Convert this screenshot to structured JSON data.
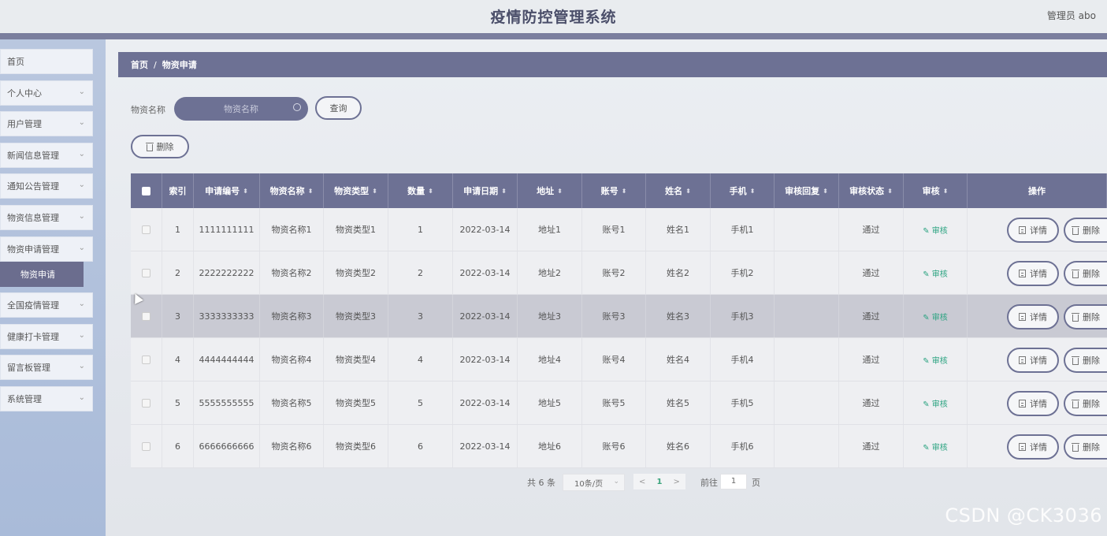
{
  "header": {
    "title": "疫情防控管理系统",
    "user": "管理员 abo"
  },
  "sidebar": {
    "items": [
      {
        "label": "首页",
        "has_chevron": false
      },
      {
        "label": "个人中心",
        "has_chevron": true
      },
      {
        "label": "用户管理",
        "has_chevron": true
      },
      {
        "label": "新闻信息管理",
        "has_chevron": true
      },
      {
        "label": "通知公告管理",
        "has_chevron": true
      },
      {
        "label": "物资信息管理",
        "has_chevron": true
      },
      {
        "label": "物资申请管理",
        "has_chevron": true
      },
      {
        "label": "全国疫情管理",
        "has_chevron": true
      },
      {
        "label": "健康打卡管理",
        "has_chevron": true
      },
      {
        "label": "留言板管理",
        "has_chevron": true
      },
      {
        "label": "系统管理",
        "has_chevron": true
      }
    ],
    "active_sub": "物资申请"
  },
  "breadcrumb": {
    "home": "首页",
    "sep": "/",
    "current": "物资申请"
  },
  "search": {
    "label": "物资名称",
    "placeholder": "物资名称",
    "button": "查询"
  },
  "toolbar": {
    "delete": "删除"
  },
  "table": {
    "headers": [
      "索引",
      "申请编号",
      "物资名称",
      "物资类型",
      "数量",
      "申请日期",
      "地址",
      "账号",
      "姓名",
      "手机",
      "审核回复",
      "审核状态",
      "审核",
      "操作"
    ],
    "rows": [
      {
        "index": "1",
        "no": "1111111111",
        "name": "物资名称1",
        "type": "物资类型1",
        "qty": "1",
        "date": "2022-03-14",
        "addr": "地址1",
        "account": "账号1",
        "person": "姓名1",
        "phone": "手机1",
        "reply": "",
        "status": "通过",
        "audit": "审核"
      },
      {
        "index": "2",
        "no": "2222222222",
        "name": "物资名称2",
        "type": "物资类型2",
        "qty": "2",
        "date": "2022-03-14",
        "addr": "地址2",
        "account": "账号2",
        "person": "姓名2",
        "phone": "手机2",
        "reply": "",
        "status": "通过",
        "audit": "审核"
      },
      {
        "index": "3",
        "no": "3333333333",
        "name": "物资名称3",
        "type": "物资类型3",
        "qty": "3",
        "date": "2022-03-14",
        "addr": "地址3",
        "account": "账号3",
        "person": "姓名3",
        "phone": "手机3",
        "reply": "",
        "status": "通过",
        "audit": "审核"
      },
      {
        "index": "4",
        "no": "4444444444",
        "name": "物资名称4",
        "type": "物资类型4",
        "qty": "4",
        "date": "2022-03-14",
        "addr": "地址4",
        "account": "账号4",
        "person": "姓名4",
        "phone": "手机4",
        "reply": "",
        "status": "通过",
        "audit": "审核"
      },
      {
        "index": "5",
        "no": "5555555555",
        "name": "物资名称5",
        "type": "物资类型5",
        "qty": "5",
        "date": "2022-03-14",
        "addr": "地址5",
        "account": "账号5",
        "person": "姓名5",
        "phone": "手机5",
        "reply": "",
        "status": "通过",
        "audit": "审核"
      },
      {
        "index": "6",
        "no": "6666666666",
        "name": "物资名称6",
        "type": "物资类型6",
        "qty": "6",
        "date": "2022-03-14",
        "addr": "地址6",
        "account": "账号6",
        "person": "姓名6",
        "phone": "手机6",
        "reply": "",
        "status": "通过",
        "audit": "审核"
      }
    ],
    "actions": {
      "detail": "详情",
      "delete": "删除"
    },
    "highlighted_row": 3
  },
  "pagination": {
    "total": "共 6 条",
    "page_size": "10条/页",
    "prev": "<",
    "current_page": "1",
    "next": ">",
    "goto_label": "前往",
    "goto_value": "1",
    "page_suffix": "页"
  },
  "watermark": "CSDN @CK3036",
  "colors": {
    "primary": "#6d7194",
    "accent_green": "#2aa380",
    "sidebar_bg": "#b0c1dc"
  }
}
